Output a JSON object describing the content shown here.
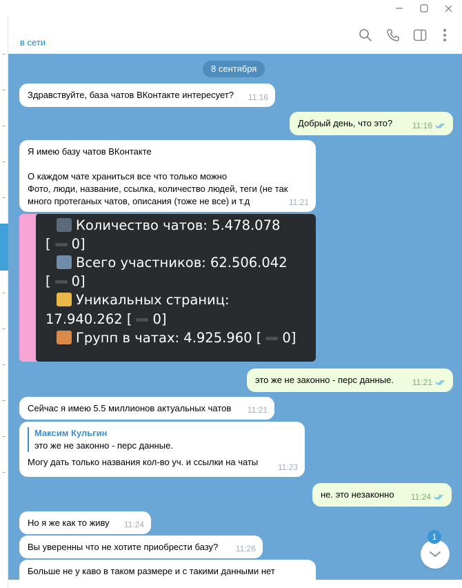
{
  "header": {
    "status": "в сети",
    "icons": [
      "search-icon",
      "phone-icon",
      "sidebar-toggle-icon",
      "more-vertical-icon"
    ]
  },
  "window_controls": [
    "minimize-icon",
    "maximize-icon",
    "close-icon"
  ],
  "chat": {
    "date_pill": "8 сентября",
    "messages": [
      {
        "dir": "in",
        "text": "Здравствуйте, база чатов ВКонтакте интересует?",
        "time": "11:16"
      },
      {
        "dir": "out",
        "text": "Добрый день, что это?",
        "time": "11:16"
      },
      {
        "dir": "in",
        "text": "Я имею базу чатов ВКонтакте\n\nО каждом чате храниться все что только можно\nФото, люди, название, ссылка, количество людей, теги (не так\nмного протеганых чатов, описания (тоже не все) и т.д",
        "time": "11:21"
      },
      {
        "dir": "out",
        "text": "это же не законно - перс данные.",
        "time": "11:21"
      },
      {
        "dir": "in",
        "text": "Сейчас я имею 5.5 миллионов актуальных чатов",
        "time": "11:21"
      },
      {
        "dir": "in",
        "reply_name": "Максим Кульгин",
        "reply_text": "это же не законно - перс данные.",
        "text": "Могу дать только названия кол-во уч. и ссылки на чаты",
        "time": "11:23"
      },
      {
        "dir": "out",
        "text": "не. это незаконно",
        "time": "11:24"
      },
      {
        "dir": "in",
        "text": "Но я же как то живу",
        "time": "11:24"
      },
      {
        "dir": "in",
        "text": "Вы уверенны что не хотите приобрести базу?",
        "time": "11:26"
      },
      {
        "dir": "in",
        "text": "Больше не у каво в таком размере и с такими данными нет",
        "time": ""
      }
    ],
    "image": {
      "line1": "Количество чатов: 5.478.078",
      "line1b_open": "[",
      "line1b_close": "0]",
      "line2": "Всего участников: 62.506.042",
      "line2b_open": "[",
      "line2b_close": "0]",
      "line3": "Уникальных страниц:",
      "line4": "17.940.262 [",
      "line4_close": "0]",
      "line5": "Групп в чатах: 4.925.960 [",
      "line5_close": "0]"
    },
    "unread_count": "1"
  },
  "colors": {
    "chat_bg": "#6aa6d6",
    "incoming": "#ffffff",
    "outgoing": "#effdde",
    "accent": "#168acd"
  }
}
